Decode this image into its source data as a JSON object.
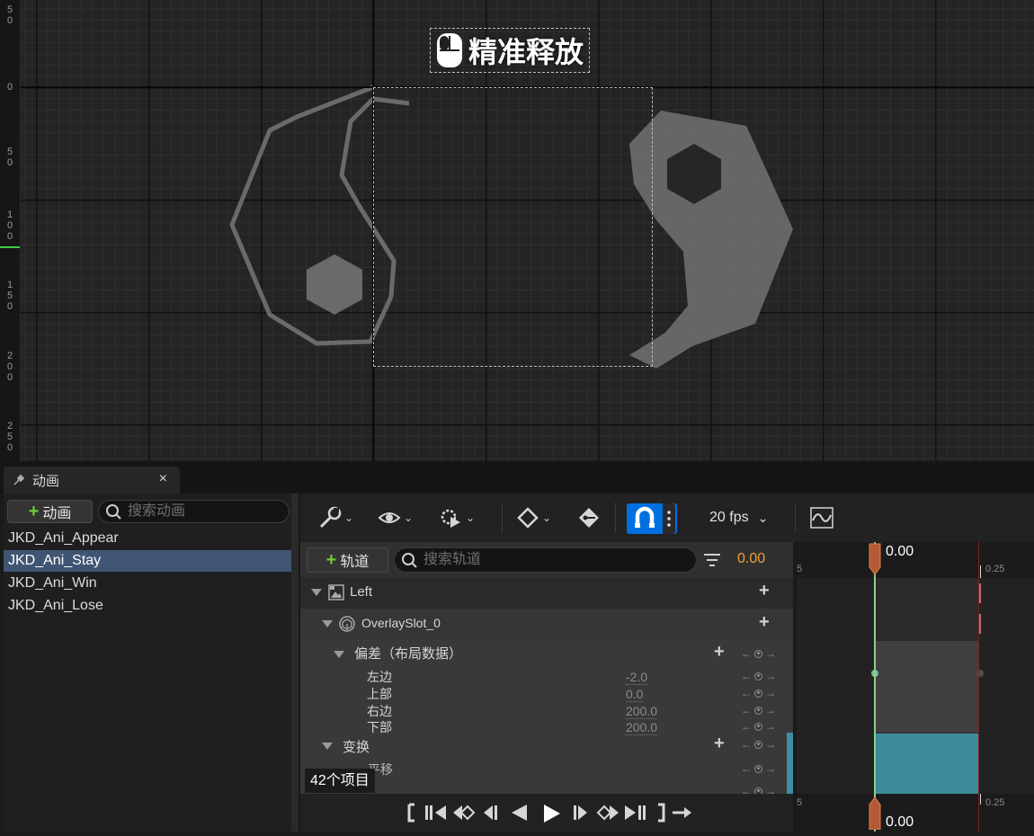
{
  "viewport": {
    "drop_label": "精准释放",
    "ruler_labels": [
      "5\n0",
      "0",
      "5\n0",
      "1\n0\n0",
      "1\n5\n0",
      "2\n0\n0",
      "2\n5\n0"
    ]
  },
  "panel": {
    "tab_title": "动画",
    "close_glyph": "×"
  },
  "animations": {
    "add_label": "动画",
    "search_placeholder": "搜索动画",
    "items": [
      "JKD_Ani_Appear",
      "JKD_Ani_Stay",
      "JKD_Ani_Win",
      "JKD_Ani_Lose"
    ],
    "selected_index": 1
  },
  "toolbar": {
    "fps_label": "20 fps",
    "snap_enabled": true,
    "accent_color": "#0070e0"
  },
  "tracks": {
    "add_label": "轨道",
    "search_placeholder": "搜索轨道",
    "current_time": "0.00",
    "rows": {
      "left": "Left",
      "overlay_slot": "OverlaySlot_0",
      "offset_group": "偏差（布局数据）",
      "left_edge": {
        "label": "左边",
        "value": "-2.0"
      },
      "top_edge": {
        "label": "上部",
        "value": "0.0"
      },
      "right_edge": {
        "label": "右边",
        "value": "200.0"
      },
      "bottom_edge": {
        "label": "下部",
        "value": "200.0"
      },
      "transform": "变换",
      "translation": "平移"
    },
    "item_count": "42个项目"
  },
  "timeline": {
    "top_time": "0.00",
    "bottom_time": "0.00",
    "tick_left": "5",
    "tick_right": "0.25",
    "playhead_color": "#c0603a"
  }
}
